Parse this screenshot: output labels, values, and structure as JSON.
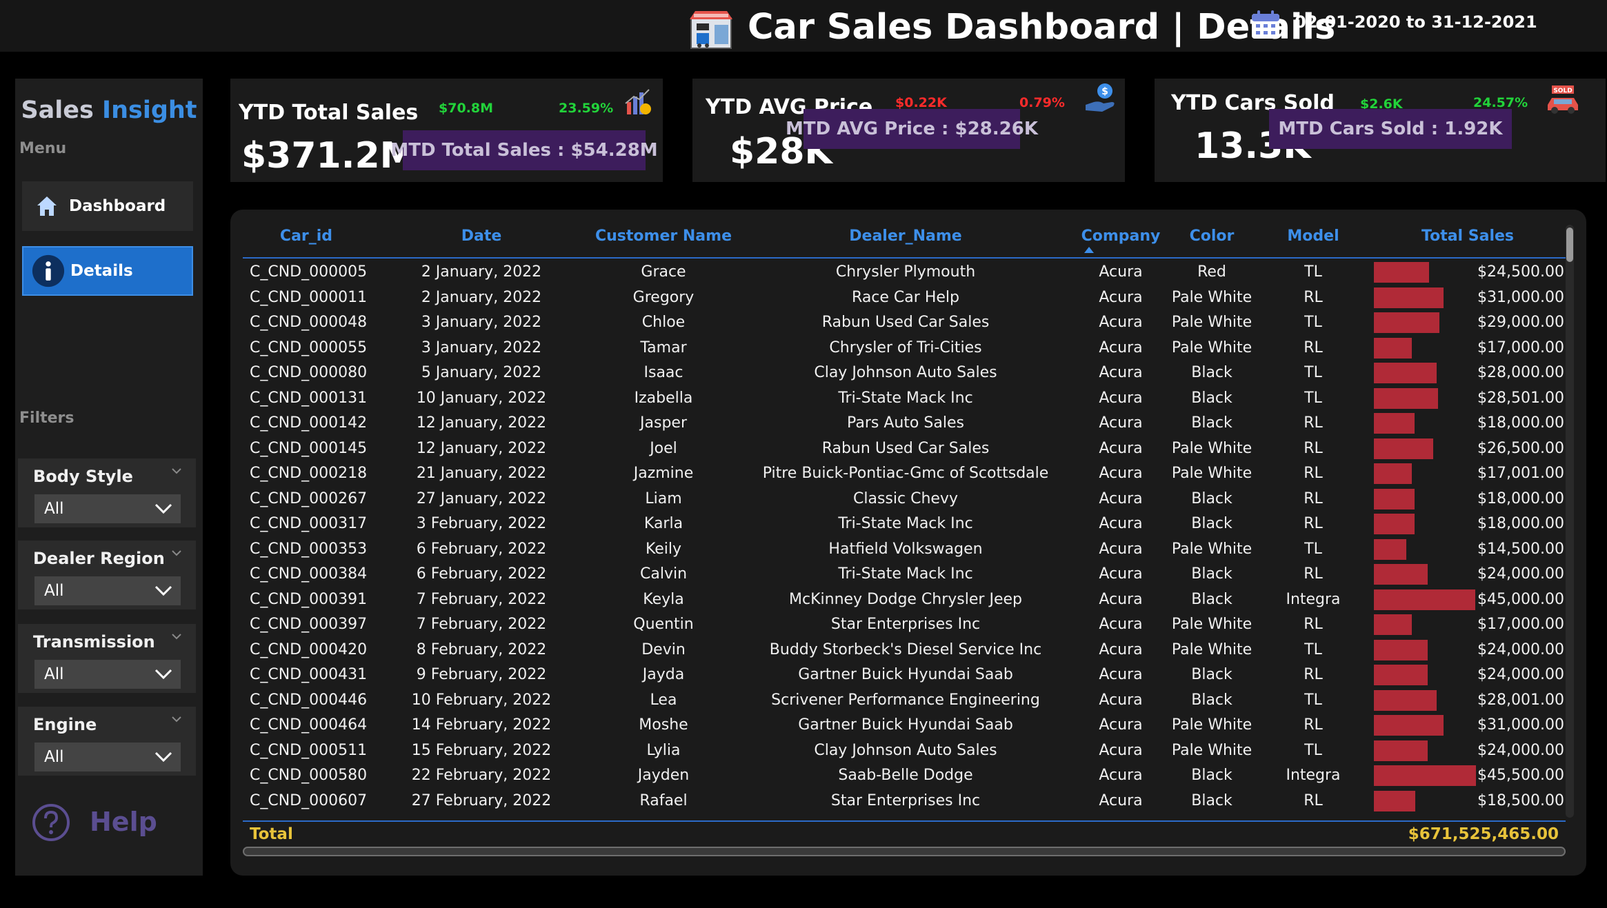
{
  "header": {
    "title": "Car Sales Dashboard | Details",
    "date_range": "02-01-2020 to 31-12-2021",
    "icons": {
      "logo": "car-dealership-icon",
      "calendar": "calendar-icon"
    }
  },
  "sidebar": {
    "brand_part1": "Sales ",
    "brand_part2": "Insight",
    "menu_label": "Menu",
    "nav": [
      {
        "label": "Dashboard",
        "icon": "home-icon"
      },
      {
        "label": "Details",
        "icon": "info-icon"
      }
    ],
    "filters_label": "Filters",
    "filters": [
      {
        "title": "Body Style",
        "value": "All"
      },
      {
        "title": "Dealer Region",
        "value": "All"
      },
      {
        "title": "Transmission",
        "value": "All"
      },
      {
        "title": "Engine",
        "value": "All"
      }
    ],
    "help_label": "Help"
  },
  "kpis": {
    "sales": {
      "title": "YTD Total Sales",
      "value": "$371.2M",
      "delta_abs": "$70.8M",
      "delta_pct": "23.59%",
      "mtd": "MTD Total Sales : $54.28M",
      "icon": "bar-chart-icon"
    },
    "price": {
      "title": "YTD AVG Price",
      "value": "$28K",
      "delta_abs": "$0.22K",
      "delta_pct": "0.79%",
      "mtd": "MTD AVG Price : $28.26K",
      "icon": "money-hand-icon"
    },
    "cars": {
      "title": "YTD Cars Sold",
      "value": "13.3K",
      "delta_abs": "$2.6K",
      "delta_pct": "24.57%",
      "mtd": "MTD Cars Sold : 1.92K",
      "icon": "sold-car-icon",
      "icon_badge": "SOLD"
    }
  },
  "colors": {
    "positive": "#22d33a",
    "negative": "#ff2b2b",
    "accent": "#1e6fcb",
    "bar": "#b02a37",
    "total": "#e8c33a",
    "mtd_bg": "#3d1d5c"
  },
  "table": {
    "columns": [
      "Car_id",
      "Date",
      "Customer Name",
      "Dealer_Name",
      "Company",
      "Color",
      "Model",
      "Total Sales"
    ],
    "sorted_column": "Company",
    "rows": [
      {
        "car_id": "C_CND_000005",
        "date": "2 January, 2022",
        "customer": "Grace",
        "dealer": "Chrysler Plymouth",
        "company": "Acura",
        "color": "Red",
        "model": "TL",
        "sales": 24500,
        "sales_label": "$24,500.00"
      },
      {
        "car_id": "C_CND_000011",
        "date": "2 January, 2022",
        "customer": "Gregory",
        "dealer": "Race Car Help",
        "company": "Acura",
        "color": "Pale White",
        "model": "RL",
        "sales": 31000,
        "sales_label": "$31,000.00"
      },
      {
        "car_id": "C_CND_000048",
        "date": "3 January, 2022",
        "customer": "Chloe",
        "dealer": "Rabun Used Car Sales",
        "company": "Acura",
        "color": "Pale White",
        "model": "TL",
        "sales": 29000,
        "sales_label": "$29,000.00"
      },
      {
        "car_id": "C_CND_000055",
        "date": "3 January, 2022",
        "customer": "Tamar",
        "dealer": "Chrysler of Tri-Cities",
        "company": "Acura",
        "color": "Pale White",
        "model": "RL",
        "sales": 17000,
        "sales_label": "$17,000.00"
      },
      {
        "car_id": "C_CND_000080",
        "date": "5 January, 2022",
        "customer": "Isaac",
        "dealer": "Clay Johnson Auto Sales",
        "company": "Acura",
        "color": "Black",
        "model": "TL",
        "sales": 28000,
        "sales_label": "$28,000.00"
      },
      {
        "car_id": "C_CND_000131",
        "date": "10 January, 2022",
        "customer": "Izabella",
        "dealer": "Tri-State Mack Inc",
        "company": "Acura",
        "color": "Black",
        "model": "TL",
        "sales": 28501,
        "sales_label": "$28,501.00"
      },
      {
        "car_id": "C_CND_000142",
        "date": "12 January, 2022",
        "customer": "Jasper",
        "dealer": "Pars Auto Sales",
        "company": "Acura",
        "color": "Black",
        "model": "RL",
        "sales": 18000,
        "sales_label": "$18,000.00"
      },
      {
        "car_id": "C_CND_000145",
        "date": "12 January, 2022",
        "customer": "Joel",
        "dealer": "Rabun Used Car Sales",
        "company": "Acura",
        "color": "Pale White",
        "model": "RL",
        "sales": 26500,
        "sales_label": "$26,500.00"
      },
      {
        "car_id": "C_CND_000218",
        "date": "21 January, 2022",
        "customer": "Jazmine",
        "dealer": "Pitre Buick-Pontiac-Gmc of Scottsdale",
        "company": "Acura",
        "color": "Pale White",
        "model": "RL",
        "sales": 17001,
        "sales_label": "$17,001.00"
      },
      {
        "car_id": "C_CND_000267",
        "date": "27 January, 2022",
        "customer": "Liam",
        "dealer": "Classic Chevy",
        "company": "Acura",
        "color": "Black",
        "model": "RL",
        "sales": 18000,
        "sales_label": "$18,000.00"
      },
      {
        "car_id": "C_CND_000317",
        "date": "3 February, 2022",
        "customer": "Karla",
        "dealer": "Tri-State Mack Inc",
        "company": "Acura",
        "color": "Black",
        "model": "RL",
        "sales": 18000,
        "sales_label": "$18,000.00"
      },
      {
        "car_id": "C_CND_000353",
        "date": "6 February, 2022",
        "customer": "Keily",
        "dealer": "Hatfield Volkswagen",
        "company": "Acura",
        "color": "Pale White",
        "model": "TL",
        "sales": 14500,
        "sales_label": "$14,500.00"
      },
      {
        "car_id": "C_CND_000384",
        "date": "6 February, 2022",
        "customer": "Calvin",
        "dealer": "Tri-State Mack Inc",
        "company": "Acura",
        "color": "Black",
        "model": "RL",
        "sales": 24000,
        "sales_label": "$24,000.00"
      },
      {
        "car_id": "C_CND_000391",
        "date": "7 February, 2022",
        "customer": "Keyla",
        "dealer": "McKinney Dodge Chrysler Jeep",
        "company": "Acura",
        "color": "Black",
        "model": "Integra",
        "sales": 45000,
        "sales_label": "$45,000.00"
      },
      {
        "car_id": "C_CND_000397",
        "date": "7 February, 2022",
        "customer": "Quentin",
        "dealer": "Star Enterprises Inc",
        "company": "Acura",
        "color": "Pale White",
        "model": "RL",
        "sales": 17000,
        "sales_label": "$17,000.00"
      },
      {
        "car_id": "C_CND_000420",
        "date": "8 February, 2022",
        "customer": "Devin",
        "dealer": "Buddy Storbeck's Diesel Service Inc",
        "company": "Acura",
        "color": "Pale White",
        "model": "TL",
        "sales": 24000,
        "sales_label": "$24,000.00"
      },
      {
        "car_id": "C_CND_000431",
        "date": "9 February, 2022",
        "customer": "Jayda",
        "dealer": "Gartner Buick Hyundai Saab",
        "company": "Acura",
        "color": "Black",
        "model": "RL",
        "sales": 24000,
        "sales_label": "$24,000.00"
      },
      {
        "car_id": "C_CND_000446",
        "date": "10 February, 2022",
        "customer": "Lea",
        "dealer": "Scrivener Performance Engineering",
        "company": "Acura",
        "color": "Black",
        "model": "TL",
        "sales": 28001,
        "sales_label": "$28,001.00"
      },
      {
        "car_id": "C_CND_000464",
        "date": "14 February, 2022",
        "customer": "Moshe",
        "dealer": "Gartner Buick Hyundai Saab",
        "company": "Acura",
        "color": "Pale White",
        "model": "RL",
        "sales": 31000,
        "sales_label": "$31,000.00"
      },
      {
        "car_id": "C_CND_000511",
        "date": "15 February, 2022",
        "customer": "Lylia",
        "dealer": "Clay Johnson Auto Sales",
        "company": "Acura",
        "color": "Pale White",
        "model": "TL",
        "sales": 24000,
        "sales_label": "$24,000.00"
      },
      {
        "car_id": "C_CND_000580",
        "date": "22 February, 2022",
        "customer": "Jayden",
        "dealer": "Saab-Belle Dodge",
        "company": "Acura",
        "color": "Black",
        "model": "Integra",
        "sales": 45500,
        "sales_label": "$45,500.00"
      },
      {
        "car_id": "C_CND_000607",
        "date": "27 February, 2022",
        "customer": "Rafael",
        "dealer": "Star Enterprises Inc",
        "company": "Acura",
        "color": "Black",
        "model": "RL",
        "sales": 18500,
        "sales_label": "$18,500.00"
      }
    ],
    "total_label": "Total",
    "total_value": "$671,525,465.00"
  }
}
